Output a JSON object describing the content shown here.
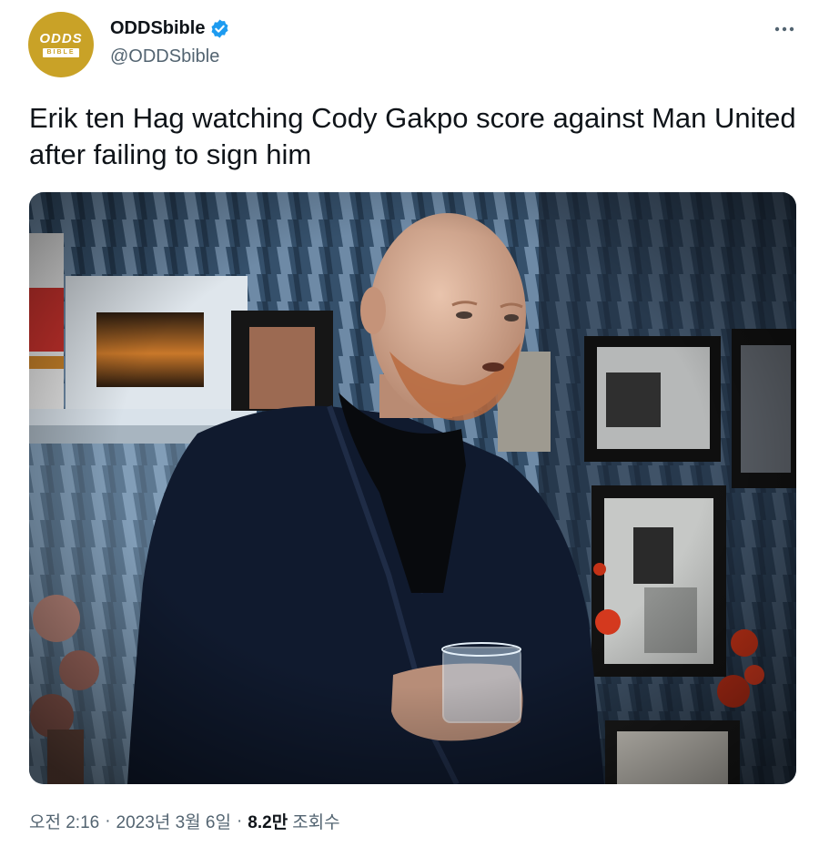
{
  "author": {
    "display_name": "ODDSbible",
    "handle": "@ODDSbible",
    "avatar_logo_top": "ODDS",
    "avatar_logo_bottom": "BIBLE",
    "verified": true,
    "verified_icon": "verified-badge-icon"
  },
  "tweet": {
    "text": "Erik ten Hag watching Cody Gakpo score against Man United after failing to sign him",
    "time": "오전 2:16",
    "date": "2023년 3월 6일",
    "views_count": "8.2만",
    "views_label": "조회수",
    "separator": "·"
  },
  "menu": {
    "icon": "more-options-icon"
  },
  "colors": {
    "brand_gold": "#c9a227",
    "verified_blue": "#1d9bf0",
    "secondary_text": "#536471",
    "primary_text": "#0f1419"
  }
}
